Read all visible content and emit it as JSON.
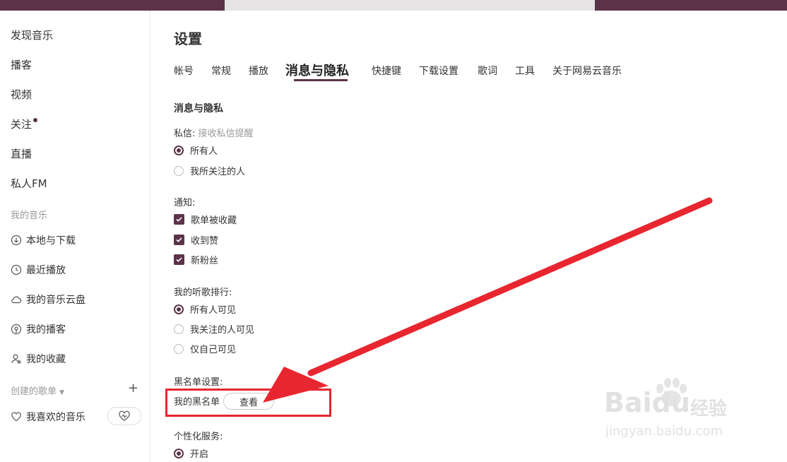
{
  "sidebar": {
    "nav": [
      {
        "label": "发现音乐"
      },
      {
        "label": "播客"
      },
      {
        "label": "视频"
      },
      {
        "label": "关注"
      },
      {
        "label": "直播"
      },
      {
        "label": "私人FM"
      }
    ],
    "my_music_label": "我的音乐",
    "library": [
      {
        "label": "本地与下载",
        "icon": "download-icon"
      },
      {
        "label": "最近播放",
        "icon": "clock-icon"
      },
      {
        "label": "我的音乐云盘",
        "icon": "cloud-icon"
      },
      {
        "label": "我的播客",
        "icon": "podcast-icon"
      },
      {
        "label": "我的收藏",
        "icon": "user-star-icon"
      }
    ],
    "created_playlists_label": "创建的歌单",
    "liked_music_label": "我喜欢的音乐"
  },
  "main": {
    "title": "设置",
    "tabs": [
      {
        "label": "帐号"
      },
      {
        "label": "常规"
      },
      {
        "label": "播放"
      },
      {
        "label": "消息与隐私"
      },
      {
        "label": "快捷键"
      },
      {
        "label": "下载设置"
      },
      {
        "label": "歌词"
      },
      {
        "label": "工具"
      },
      {
        "label": "关于网易云音乐"
      }
    ],
    "active_tab": "消息与隐私",
    "section_title": "消息与隐私",
    "private_msg": {
      "label": "私信:",
      "hint": "接收私信提醒",
      "options": [
        "所有人",
        "我所关注的人"
      ],
      "selected": "所有人"
    },
    "notify": {
      "label": "通知:",
      "options": [
        "歌单被收藏",
        "收到赞",
        "新粉丝"
      ]
    },
    "ranking": {
      "label": "我的听歌排行:",
      "options": [
        "所有人可见",
        "我关注的人可见",
        "仅自己可见"
      ],
      "selected": "所有人可见"
    },
    "blacklist": {
      "label": "黑名单设置:",
      "item_label": "我的黑名单",
      "button": "查看"
    },
    "personalized": {
      "label": "个性化服务:",
      "option": "开启"
    }
  },
  "watermark": {
    "brand": "Baidu",
    "cn": "经验",
    "url": "jingyan.baidu.com"
  },
  "colors": {
    "accent": "#5c3349",
    "annotation": "#e8262f"
  }
}
